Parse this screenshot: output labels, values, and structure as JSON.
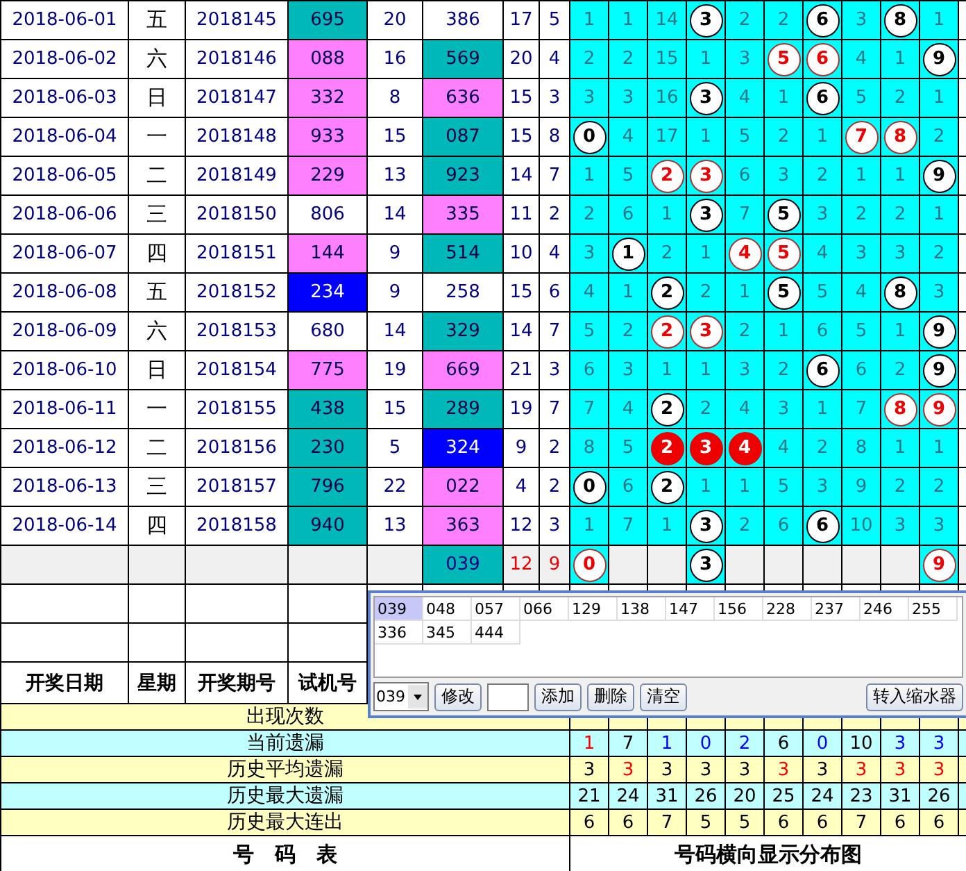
{
  "rows": [
    {
      "date": "2018-06-01",
      "weekday": "五",
      "period": "2018145",
      "test_number": {
        "text": "695",
        "color": "#00b8b8"
      },
      "column_6": "20",
      "column_7": {
        "text": "386",
        "color": "#ffffff"
      },
      "column_8": "17",
      "column_9": "5",
      "dist": [
        {
          "kind": "miss",
          "text": "1"
        },
        {
          "kind": "miss",
          "text": "1"
        },
        {
          "kind": "miss",
          "text": "14"
        },
        {
          "kind": "hit",
          "text": "3"
        },
        {
          "kind": "miss",
          "text": "2"
        },
        {
          "kind": "miss",
          "text": "2"
        },
        {
          "kind": "hit",
          "text": "6"
        },
        {
          "kind": "miss",
          "text": "3"
        },
        {
          "kind": "hit",
          "text": "8"
        },
        {
          "kind": "miss",
          "text": "1"
        }
      ]
    },
    {
      "date": "2018-06-02",
      "weekday": "六",
      "period": "2018146",
      "test_number": {
        "text": "088",
        "color": "#ff80ff"
      },
      "column_6": "16",
      "column_7": {
        "text": "569",
        "color": "#00b8b8"
      },
      "column_8": "20",
      "column_9": "4",
      "dist": [
        {
          "kind": "miss",
          "text": "2"
        },
        {
          "kind": "miss",
          "text": "2"
        },
        {
          "kind": "miss",
          "text": "15"
        },
        {
          "kind": "miss",
          "text": "1"
        },
        {
          "kind": "miss",
          "text": "3"
        },
        {
          "kind": "hit_red",
          "text": "5"
        },
        {
          "kind": "hit_red",
          "text": "6"
        },
        {
          "kind": "miss",
          "text": "4"
        },
        {
          "kind": "miss",
          "text": "1"
        },
        {
          "kind": "hit",
          "text": "9"
        }
      ]
    },
    {
      "date": "2018-06-03",
      "weekday": "日",
      "period": "2018147",
      "test_number": {
        "text": "332",
        "color": "#ff80ff"
      },
      "column_6": "8",
      "column_7": {
        "text": "636",
        "color": "#ff80ff"
      },
      "column_8": "15",
      "column_9": "3",
      "dist": [
        {
          "kind": "miss",
          "text": "3"
        },
        {
          "kind": "miss",
          "text": "3"
        },
        {
          "kind": "miss",
          "text": "16"
        },
        {
          "kind": "hit",
          "text": "3"
        },
        {
          "kind": "miss",
          "text": "4"
        },
        {
          "kind": "miss",
          "text": "1"
        },
        {
          "kind": "hit",
          "text": "6"
        },
        {
          "kind": "miss",
          "text": "5"
        },
        {
          "kind": "miss",
          "text": "2"
        },
        {
          "kind": "miss",
          "text": "1"
        }
      ]
    },
    {
      "date": "2018-06-04",
      "weekday": "一",
      "period": "2018148",
      "test_number": {
        "text": "933",
        "color": "#ff80ff"
      },
      "column_6": "15",
      "column_7": {
        "text": "087",
        "color": "#00b8b8"
      },
      "column_8": "15",
      "column_9": "8",
      "dist": [
        {
          "kind": "hit",
          "text": "0"
        },
        {
          "kind": "miss",
          "text": "4"
        },
        {
          "kind": "miss",
          "text": "17"
        },
        {
          "kind": "miss",
          "text": "1"
        },
        {
          "kind": "miss",
          "text": "5"
        },
        {
          "kind": "miss",
          "text": "2"
        },
        {
          "kind": "miss",
          "text": "1"
        },
        {
          "kind": "hit_red",
          "text": "7"
        },
        {
          "kind": "hit_red",
          "text": "8"
        },
        {
          "kind": "miss",
          "text": "2"
        }
      ]
    },
    {
      "date": "2018-06-05",
      "weekday": "二",
      "period": "2018149",
      "test_number": {
        "text": "229",
        "color": "#ff80ff"
      },
      "column_6": "13",
      "column_7": {
        "text": "923",
        "color": "#00b8b8"
      },
      "column_8": "14",
      "column_9": "7",
      "dist": [
        {
          "kind": "miss",
          "text": "1"
        },
        {
          "kind": "miss",
          "text": "5"
        },
        {
          "kind": "hit_red",
          "text": "2"
        },
        {
          "kind": "hit_red",
          "text": "3"
        },
        {
          "kind": "miss",
          "text": "6"
        },
        {
          "kind": "miss",
          "text": "3"
        },
        {
          "kind": "miss",
          "text": "2"
        },
        {
          "kind": "miss",
          "text": "1"
        },
        {
          "kind": "miss",
          "text": "1"
        },
        {
          "kind": "hit",
          "text": "9"
        }
      ]
    },
    {
      "date": "2018-06-06",
      "weekday": "三",
      "period": "2018150",
      "test_number": {
        "text": "806",
        "color": "#ffffff"
      },
      "column_6": "14",
      "column_7": {
        "text": "335",
        "color": "#ff80ff"
      },
      "column_8": "11",
      "column_9": "2",
      "dist": [
        {
          "kind": "miss",
          "text": "2"
        },
        {
          "kind": "miss",
          "text": "6"
        },
        {
          "kind": "miss",
          "text": "1"
        },
        {
          "kind": "hit",
          "text": "3"
        },
        {
          "kind": "miss",
          "text": "7"
        },
        {
          "kind": "hit",
          "text": "5"
        },
        {
          "kind": "miss",
          "text": "3"
        },
        {
          "kind": "miss",
          "text": "2"
        },
        {
          "kind": "miss",
          "text": "2"
        },
        {
          "kind": "miss",
          "text": "1"
        }
      ]
    },
    {
      "date": "2018-06-07",
      "weekday": "四",
      "period": "2018151",
      "test_number": {
        "text": "144",
        "color": "#ff80ff"
      },
      "column_6": "9",
      "column_7": {
        "text": "514",
        "color": "#00b8b8"
      },
      "column_8": "10",
      "column_9": "4",
      "dist": [
        {
          "kind": "miss",
          "text": "3"
        },
        {
          "kind": "hit",
          "text": "1"
        },
        {
          "kind": "miss",
          "text": "2"
        },
        {
          "kind": "miss",
          "text": "1"
        },
        {
          "kind": "hit_red",
          "text": "4"
        },
        {
          "kind": "hit_red",
          "text": "5"
        },
        {
          "kind": "miss",
          "text": "4"
        },
        {
          "kind": "miss",
          "text": "3"
        },
        {
          "kind": "miss",
          "text": "3"
        },
        {
          "kind": "miss",
          "text": "2"
        }
      ]
    },
    {
      "date": "2018-06-08",
      "weekday": "五",
      "period": "2018152",
      "test_number": {
        "text": "234",
        "color": "#0000ff"
      },
      "column_6": "9",
      "column_7": {
        "text": "258",
        "color": "#ffffff"
      },
      "column_8": "15",
      "column_9": "6",
      "dist": [
        {
          "kind": "miss",
          "text": "4"
        },
        {
          "kind": "miss",
          "text": "1"
        },
        {
          "kind": "hit",
          "text": "2"
        },
        {
          "kind": "miss",
          "text": "2"
        },
        {
          "kind": "miss",
          "text": "1"
        },
        {
          "kind": "hit",
          "text": "5"
        },
        {
          "kind": "miss",
          "text": "5"
        },
        {
          "kind": "miss",
          "text": "4"
        },
        {
          "kind": "hit",
          "text": "8"
        },
        {
          "kind": "miss",
          "text": "3"
        }
      ]
    },
    {
      "date": "2018-06-09",
      "weekday": "六",
      "period": "2018153",
      "test_number": {
        "text": "680",
        "color": "#ffffff"
      },
      "column_6": "14",
      "column_7": {
        "text": "329",
        "color": "#00b8b8"
      },
      "column_8": "14",
      "column_9": "7",
      "dist": [
        {
          "kind": "miss",
          "text": "5"
        },
        {
          "kind": "miss",
          "text": "2"
        },
        {
          "kind": "hit_red",
          "text": "2"
        },
        {
          "kind": "hit_red",
          "text": "3"
        },
        {
          "kind": "miss",
          "text": "2"
        },
        {
          "kind": "miss",
          "text": "1"
        },
        {
          "kind": "miss",
          "text": "6"
        },
        {
          "kind": "miss",
          "text": "5"
        },
        {
          "kind": "miss",
          "text": "1"
        },
        {
          "kind": "hit",
          "text": "9"
        }
      ]
    },
    {
      "date": "2018-06-10",
      "weekday": "日",
      "period": "2018154",
      "test_number": {
        "text": "775",
        "color": "#ff80ff"
      },
      "column_6": "19",
      "column_7": {
        "text": "669",
        "color": "#ff80ff"
      },
      "column_8": "21",
      "column_9": "3",
      "dist": [
        {
          "kind": "miss",
          "text": "6"
        },
        {
          "kind": "miss",
          "text": "3"
        },
        {
          "kind": "miss",
          "text": "1"
        },
        {
          "kind": "miss",
          "text": "1"
        },
        {
          "kind": "miss",
          "text": "3"
        },
        {
          "kind": "miss",
          "text": "2"
        },
        {
          "kind": "hit",
          "text": "6"
        },
        {
          "kind": "miss",
          "text": "6"
        },
        {
          "kind": "miss",
          "text": "2"
        },
        {
          "kind": "hit",
          "text": "9"
        }
      ]
    },
    {
      "date": "2018-06-11",
      "weekday": "一",
      "period": "2018155",
      "test_number": {
        "text": "438",
        "color": "#00b8b8"
      },
      "column_6": "15",
      "column_7": {
        "text": "289",
        "color": "#00b8b8"
      },
      "column_8": "19",
      "column_9": "7",
      "dist": [
        {
          "kind": "miss",
          "text": "7"
        },
        {
          "kind": "miss",
          "text": "4"
        },
        {
          "kind": "hit",
          "text": "2"
        },
        {
          "kind": "miss",
          "text": "2"
        },
        {
          "kind": "miss",
          "text": "4"
        },
        {
          "kind": "miss",
          "text": "3"
        },
        {
          "kind": "miss",
          "text": "1"
        },
        {
          "kind": "miss",
          "text": "7"
        },
        {
          "kind": "hit_red",
          "text": "8"
        },
        {
          "kind": "hit_red",
          "text": "9"
        }
      ]
    },
    {
      "date": "2018-06-12",
      "weekday": "二",
      "period": "2018156",
      "test_number": {
        "text": "230",
        "color": "#00b8b8"
      },
      "column_6": "5",
      "column_7": {
        "text": "324",
        "color": "#0000ff"
      },
      "column_8": "9",
      "column_9": "2",
      "dist": [
        {
          "kind": "miss",
          "text": "8"
        },
        {
          "kind": "miss",
          "text": "5"
        },
        {
          "kind": "hit_filled",
          "text": "2"
        },
        {
          "kind": "hit_filled",
          "text": "3"
        },
        {
          "kind": "hit_filled",
          "text": "4"
        },
        {
          "kind": "miss",
          "text": "4"
        },
        {
          "kind": "miss",
          "text": "2"
        },
        {
          "kind": "miss",
          "text": "8"
        },
        {
          "kind": "miss",
          "text": "1"
        },
        {
          "kind": "miss",
          "text": "1"
        }
      ]
    },
    {
      "date": "2018-06-13",
      "weekday": "三",
      "period": "2018157",
      "test_number": {
        "text": "796",
        "color": "#00b8b8"
      },
      "column_6": "22",
      "column_7": {
        "text": "022",
        "color": "#ff80ff"
      },
      "column_8": "4",
      "column_9": "2",
      "dist": [
        {
          "kind": "hit",
          "text": "0"
        },
        {
          "kind": "miss",
          "text": "6"
        },
        {
          "kind": "hit",
          "text": "2"
        },
        {
          "kind": "miss",
          "text": "1"
        },
        {
          "kind": "miss",
          "text": "1"
        },
        {
          "kind": "miss",
          "text": "5"
        },
        {
          "kind": "miss",
          "text": "3"
        },
        {
          "kind": "miss",
          "text": "9"
        },
        {
          "kind": "miss",
          "text": "2"
        },
        {
          "kind": "miss",
          "text": "2"
        }
      ]
    },
    {
      "date": "2018-06-14",
      "weekday": "四",
      "period": "2018158",
      "test_number": {
        "text": "940",
        "color": "#00b8b8"
      },
      "column_6": "13",
      "column_7": {
        "text": "363",
        "color": "#ff80ff"
      },
      "column_8": "12",
      "column_9": "3",
      "dist": [
        {
          "kind": "miss",
          "text": "1"
        },
        {
          "kind": "miss",
          "text": "7"
        },
        {
          "kind": "miss",
          "text": "1"
        },
        {
          "kind": "hit",
          "text": "3"
        },
        {
          "kind": "miss",
          "text": "2"
        },
        {
          "kind": "miss",
          "text": "6"
        },
        {
          "kind": "hit",
          "text": "6"
        },
        {
          "kind": "miss",
          "text": "10"
        },
        {
          "kind": "miss",
          "text": "3"
        },
        {
          "kind": "miss",
          "text": "3"
        }
      ]
    }
  ],
  "forecast_row": {
    "column_7": {
      "text": "039",
      "color": "#00b8b8"
    },
    "column_8": "12",
    "column_9": "9",
    "dist": [
      {
        "kind": "hit_red",
        "text": "0"
      },
      {
        "kind": "empty"
      },
      {
        "kind": "empty"
      },
      {
        "kind": "hit",
        "text": "3"
      },
      {
        "kind": "empty"
      },
      {
        "kind": "empty"
      },
      {
        "kind": "empty"
      },
      {
        "kind": "empty"
      },
      {
        "kind": "empty"
      },
      {
        "kind": "hit_red",
        "text": "9"
      }
    ]
  },
  "headers": [
    "开奖日期",
    "星期",
    "开奖期号",
    "试机号"
  ],
  "stats": [
    {
      "label": "出现次数"
    },
    {
      "label": "当前遗漏",
      "values": [
        {
          "text": "1",
          "color": "#ff0000"
        },
        {
          "text": "7",
          "color": "#000000"
        },
        {
          "text": "1",
          "color": "#0000ff"
        },
        {
          "text": "0",
          "color": "#0000ff"
        },
        {
          "text": "2",
          "color": "#0000ff"
        },
        {
          "text": "6",
          "color": "#000000"
        },
        {
          "text": "0",
          "color": "#0000ff"
        },
        {
          "text": "10",
          "color": "#000000"
        },
        {
          "text": "3",
          "color": "#0000ff"
        },
        {
          "text": "3",
          "color": "#0000ff"
        }
      ]
    },
    {
      "label": "历史平均遗漏",
      "values": [
        {
          "text": "3",
          "color": "#000000"
        },
        {
          "text": "3",
          "color": "#ff0000"
        },
        {
          "text": "3",
          "color": "#000000"
        },
        {
          "text": "3",
          "color": "#000000"
        },
        {
          "text": "3",
          "color": "#000000"
        },
        {
          "text": "3",
          "color": "#ff0000"
        },
        {
          "text": "3",
          "color": "#000000"
        },
        {
          "text": "3",
          "color": "#ff0000"
        },
        {
          "text": "3",
          "color": "#ff0000"
        },
        {
          "text": "3",
          "color": "#ff0000"
        }
      ]
    },
    {
      "label": "历史最大遗漏",
      "values": [
        {
          "text": "21",
          "color": "#000000"
        },
        {
          "text": "24",
          "color": "#000000"
        },
        {
          "text": "31",
          "color": "#000000"
        },
        {
          "text": "26",
          "color": "#000000"
        },
        {
          "text": "20",
          "color": "#000000"
        },
        {
          "text": "25",
          "color": "#000000"
        },
        {
          "text": "24",
          "color": "#000000"
        },
        {
          "text": "23",
          "color": "#000000"
        },
        {
          "text": "31",
          "color": "#000000"
        },
        {
          "text": "26",
          "color": "#000000"
        }
      ]
    },
    {
      "label": "历史最大连出",
      "values": [
        {
          "text": "6",
          "color": "#000000"
        },
        {
          "text": "6",
          "color": "#000000"
        },
        {
          "text": "7",
          "color": "#000000"
        },
        {
          "text": "5",
          "color": "#000000"
        },
        {
          "text": "5",
          "color": "#000000"
        },
        {
          "text": "6",
          "color": "#000000"
        },
        {
          "text": "6",
          "color": "#000000"
        },
        {
          "text": "7",
          "color": "#000000"
        },
        {
          "text": "6",
          "color": "#000000"
        },
        {
          "text": "6",
          "color": "#000000"
        }
      ]
    }
  ],
  "footer": [
    "号　码　表",
    "号码横向显示分布图"
  ],
  "popup": {
    "numbers": [
      {
        "text": "039",
        "selected": true
      },
      {
        "text": "048",
        "selected": false
      },
      {
        "text": "057",
        "selected": false
      },
      {
        "text": "066",
        "selected": false
      },
      {
        "text": "129",
        "selected": false
      },
      {
        "text": "138",
        "selected": false
      },
      {
        "text": "147",
        "selected": false
      },
      {
        "text": "156",
        "selected": false
      },
      {
        "text": "228",
        "selected": false
      },
      {
        "text": "237",
        "selected": false
      },
      {
        "text": "246",
        "selected": false
      },
      {
        "text": "255",
        "selected": false
      },
      {
        "text": "336",
        "selected": false
      },
      {
        "text": "345",
        "selected": false
      },
      {
        "text": "444",
        "selected": false
      }
    ],
    "combo": "039",
    "buttons": [
      "修改",
      "添加",
      "删除",
      "清空"
    ],
    "transfer_button": "转入缩水器"
  }
}
